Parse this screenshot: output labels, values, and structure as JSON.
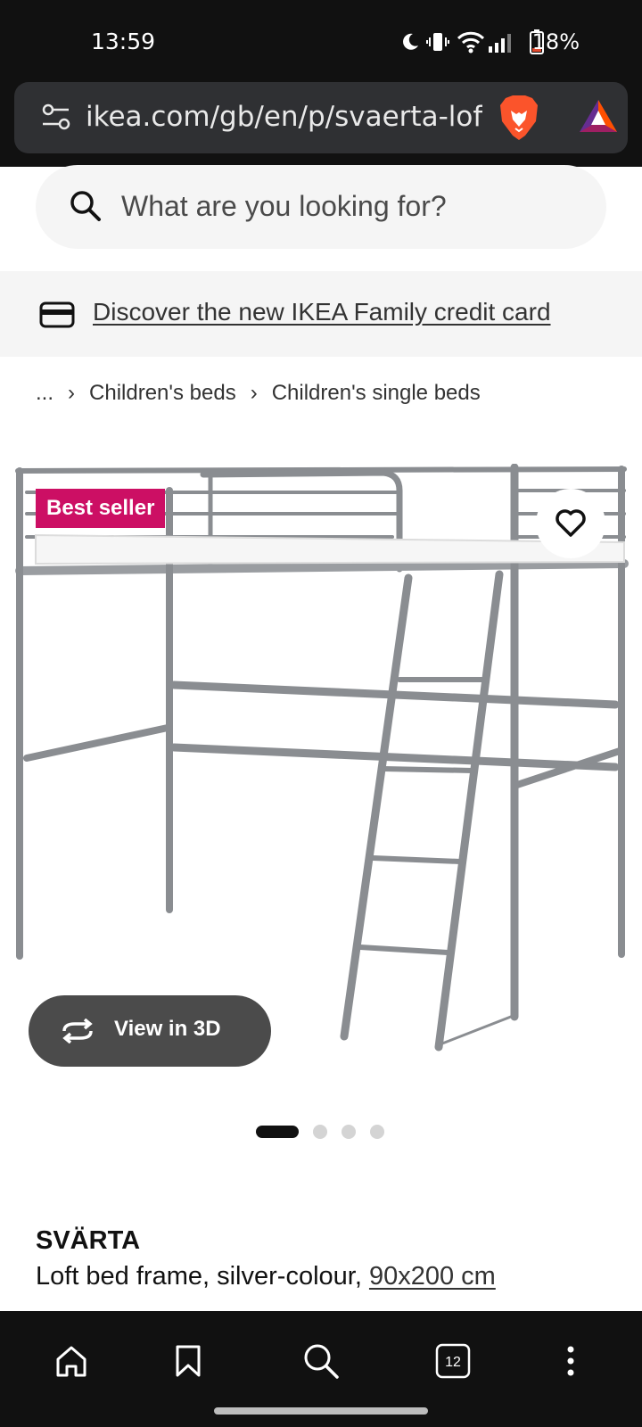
{
  "status_bar": {
    "time": "13:59",
    "battery": "18%",
    "icons": [
      "moon-icon",
      "vibrate-icon",
      "wifi-icon",
      "signal-icon",
      "battery-icon"
    ]
  },
  "browser": {
    "url": "ikea.com/gb/en/p/svaerta-loft-b",
    "icons": [
      "tune-icon",
      "brave-lion-icon",
      "bat-rewards-icon"
    ]
  },
  "search": {
    "placeholder": "What are you looking for?"
  },
  "promo": {
    "link_text": "Discover the new IKEA Family credit card"
  },
  "breadcrumb": {
    "ellipsis": "...",
    "items": [
      "Children's beds",
      "Children's single beds"
    ]
  },
  "product": {
    "badge": "Best seller",
    "view_3d_label": "View in 3D",
    "image_count": 4,
    "active_image": 1,
    "name": "SVÄRTA",
    "description": "Loft bed frame, silver-colour, ",
    "size": "90x200 cm"
  },
  "bottom_nav": {
    "tab_count": "12",
    "items": [
      "home-icon",
      "bookmark-icon",
      "search-icon",
      "tabs-icon",
      "more-icon"
    ]
  },
  "colors": {
    "badge": "#cc0f64",
    "dark_chrome": "#111111",
    "view3d_bg": "#4b4b4b",
    "page_bg": "#ffffff"
  }
}
